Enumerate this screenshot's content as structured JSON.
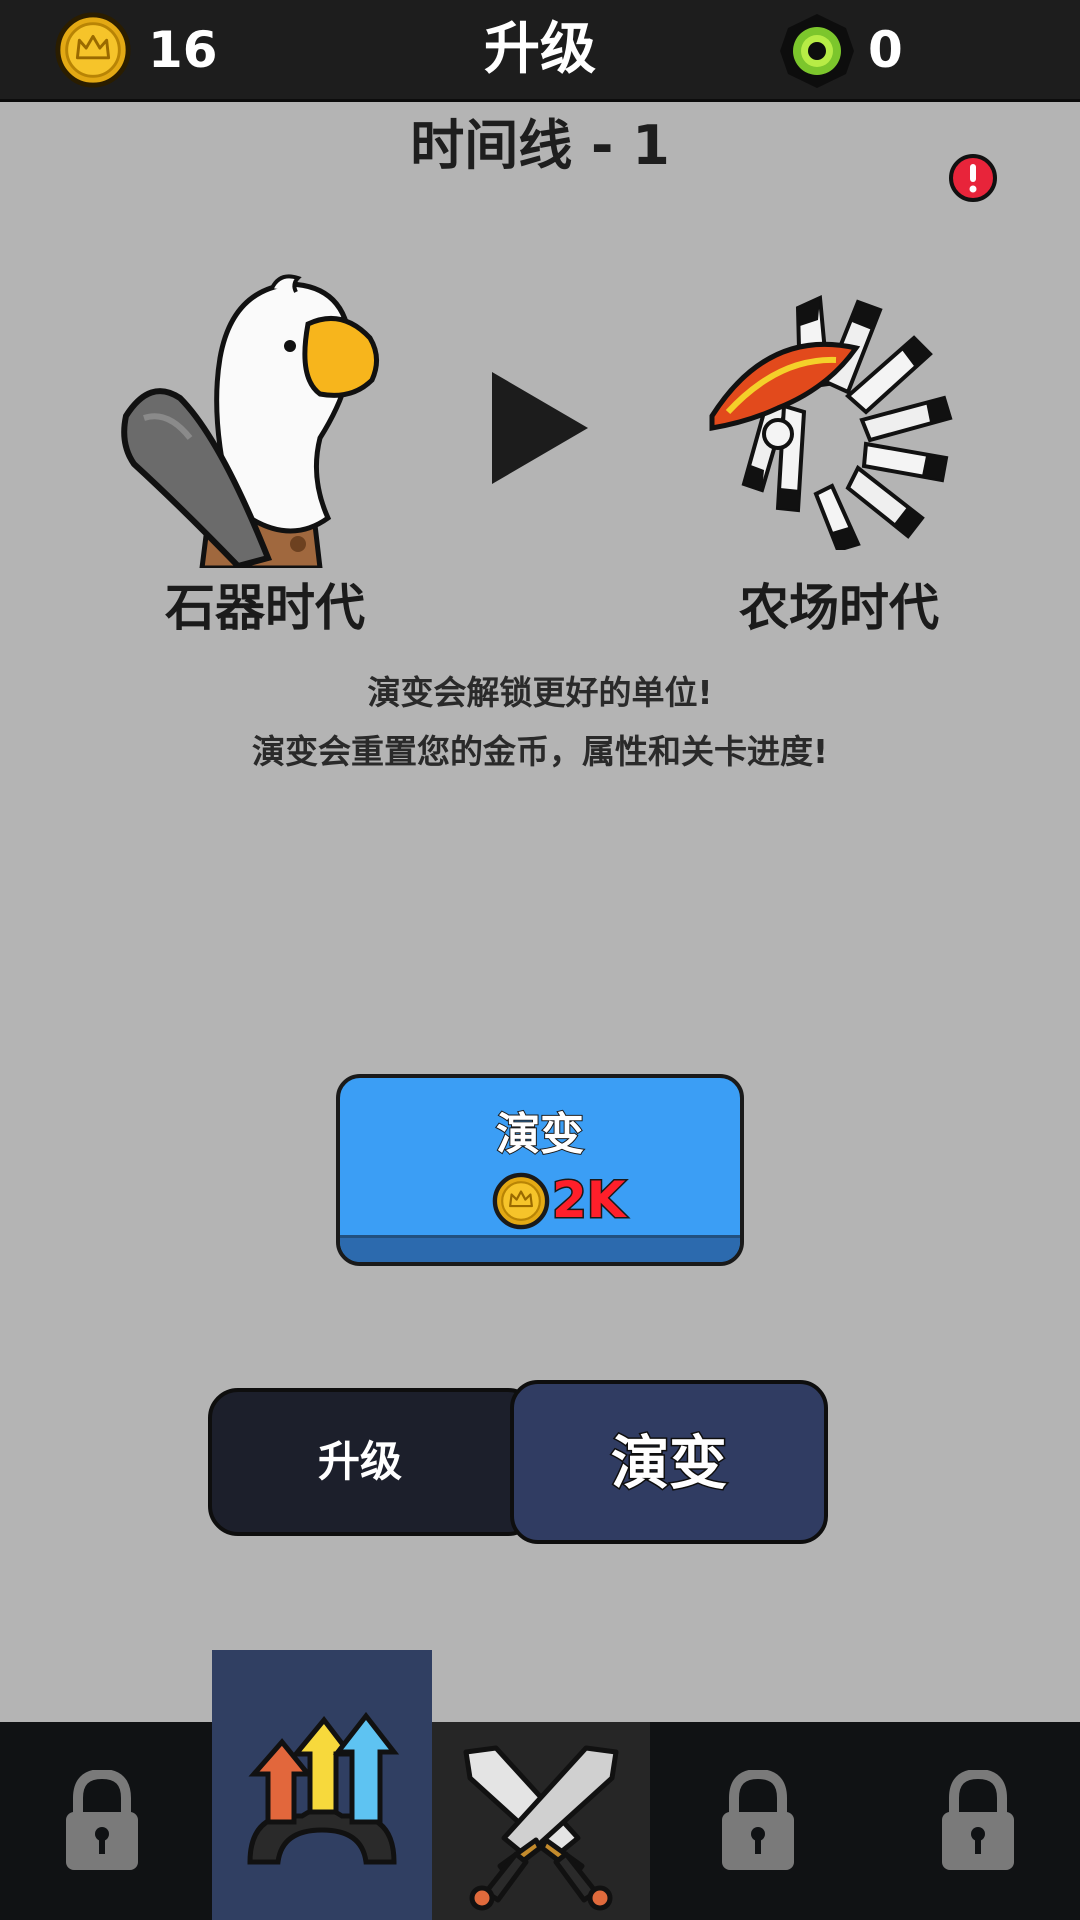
{
  "topbar": {
    "coin_icon": "crown-coin-icon",
    "coins": "16",
    "title": "升级",
    "gem_icon": "green-gem-icon",
    "gems": "0"
  },
  "timeline": {
    "title": "时间线 - 1",
    "alert_icon": "red-alert-icon"
  },
  "eras": {
    "current": {
      "label": "石器时代",
      "icon": "stone-age-duck-icon"
    },
    "next": {
      "label": "农场时代",
      "icon": "feather-headdress-icon"
    },
    "arrow_icon": "play-arrow-icon"
  },
  "info": {
    "line1": "演变会解锁更好的单位!",
    "line2": "演变会重置您的金币，属性和关卡进度!"
  },
  "evolve_button": {
    "label": "演变",
    "cost": "2K",
    "cost_color": "#ff1f2a",
    "coin_icon": "crown-coin-icon"
  },
  "toggle": {
    "upgrade_label": "升级",
    "evolve_label": "演变",
    "active": "演变"
  },
  "bottom_nav": {
    "items": [
      {
        "icon": "lock-icon",
        "state": "locked"
      },
      {
        "icon": "upgrade-arrows-icon",
        "state": "active"
      },
      {
        "icon": "crossed-swords-icon",
        "state": "normal"
      },
      {
        "icon": "lock-icon",
        "state": "locked"
      },
      {
        "icon": "lock-icon",
        "state": "locked"
      }
    ]
  },
  "colors": {
    "background": "#b4b4b4",
    "topbar": "#1d1d1d",
    "button_blue": "#3b9ef5",
    "nav_active": "#303f62"
  }
}
